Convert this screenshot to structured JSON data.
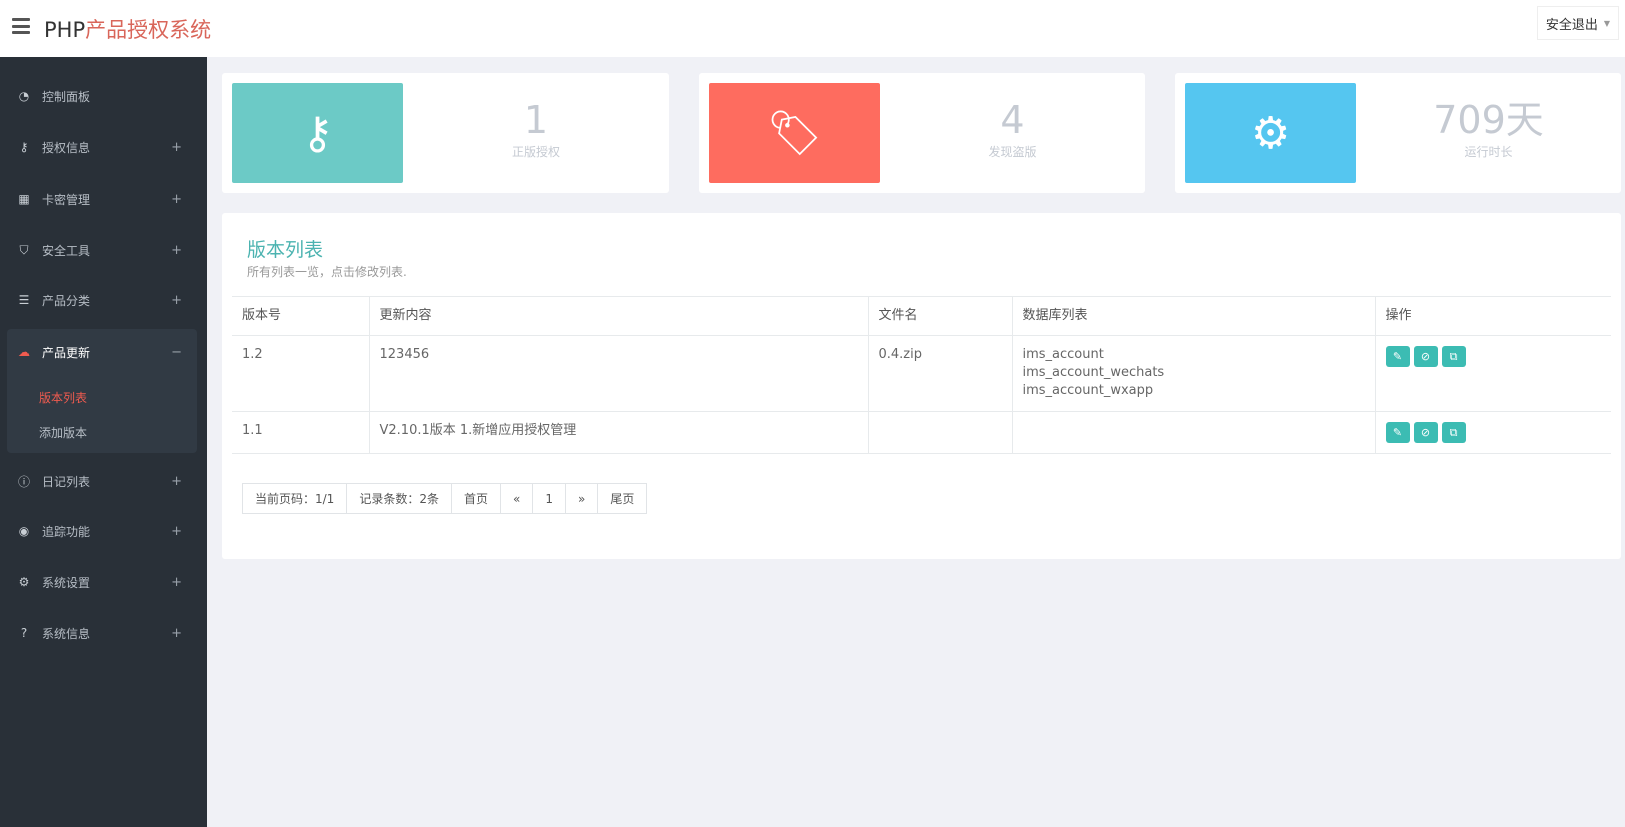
{
  "header": {
    "brand_prefix": "PHP",
    "brand_suffix": "产品授权系统",
    "logout": "安全退出"
  },
  "sidebar": {
    "items": [
      {
        "label": "控制面板",
        "icon": "dashboard-icon"
      },
      {
        "label": "授权信息",
        "icon": "key-icon",
        "toggle": "+"
      },
      {
        "label": "卡密管理",
        "icon": "qrcode-icon",
        "toggle": "+"
      },
      {
        "label": "安全工具",
        "icon": "shield-icon",
        "toggle": "+"
      },
      {
        "label": "产品分类",
        "icon": "list-icon",
        "toggle": "+"
      },
      {
        "label": "产品更新",
        "icon": "cloud-upload-icon",
        "toggle": "−"
      },
      {
        "label": "日记列表",
        "icon": "info-icon",
        "toggle": "+"
      },
      {
        "label": "追踪功能",
        "icon": "target-icon",
        "toggle": "+"
      },
      {
        "label": "系统设置",
        "icon": "gears-icon",
        "toggle": "+"
      },
      {
        "label": "系统信息",
        "icon": "question-icon",
        "toggle": "+"
      }
    ],
    "sub_items": [
      {
        "label": "版本列表"
      },
      {
        "label": "添加版本"
      }
    ]
  },
  "stats": [
    {
      "value": "1",
      "label": "正版授权",
      "color": "#6ccac6"
    },
    {
      "value": "4",
      "label": "发现盗版",
      "color": "#fe6c5f"
    },
    {
      "value": "709天",
      "label": "运行时长",
      "color": "#55c6f0"
    }
  ],
  "panel": {
    "title": "版本列表",
    "subtitle": "所有列表一览，点击修改列表.",
    "columns": [
      "版本号",
      "更新内容",
      "文件名",
      "数据库列表",
      "操作"
    ],
    "rows": [
      {
        "version": "1.2",
        "content": "123456",
        "file": "0.4.zip",
        "db": [
          "ims_account",
          "ims_account_wechats",
          "ims_account_wxapp"
        ]
      },
      {
        "version": "1.1",
        "content": "V2.10.1版本 1.新增应用授权管理",
        "file": "",
        "db": []
      }
    ]
  },
  "pager": {
    "current": "当前页码：1/1",
    "count": "记录条数：2条",
    "first": "首页",
    "prev": "«",
    "page": "1",
    "next": "»",
    "last": "尾页"
  },
  "colors": {
    "sidebar": "#293038",
    "accent": "#3cbcb3",
    "active": "#f05b4f"
  }
}
